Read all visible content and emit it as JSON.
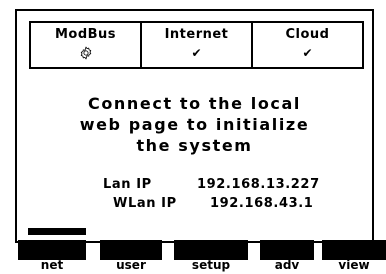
{
  "status": {
    "modbus_label": "ModBus",
    "internet_label": "Internet",
    "cloud_label": "Cloud",
    "modbus_icon": "gear-icon",
    "internet_icon": "check-icon",
    "cloud_icon": "check-icon",
    "internet_check": "✔",
    "cloud_check": "✔"
  },
  "message": {
    "line1": "Connect to the local",
    "line2": "web page to initialize",
    "line3": "the system"
  },
  "network": {
    "lan_label": "Lan IP",
    "lan_ip": "192.168.13.227",
    "wlan_label": "WLan IP",
    "wlan_ip": "192.168.43.1"
  },
  "softkeys": [
    "net",
    "user",
    "setup",
    "adv",
    "view"
  ],
  "selected_softkey": "net"
}
